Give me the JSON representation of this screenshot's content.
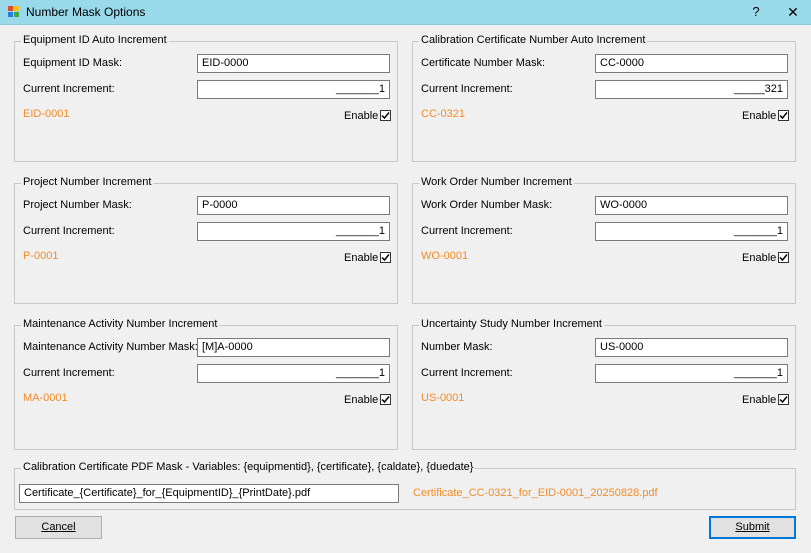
{
  "window": {
    "title": "Number Mask Options",
    "help_glyph": "?",
    "close_glyph": "✕"
  },
  "groups": [
    {
      "legend": "Equipment ID Auto Increment",
      "mask_label": "Equipment ID Mask:",
      "mask_value": "EID-0000",
      "inc_label": "Current Increment:",
      "inc_value": "_______1",
      "preview": "EID-0001",
      "enable_label": "Enable",
      "enabled": true
    },
    {
      "legend": "Calibration Certificate Number Auto Increment",
      "mask_label": "Certificate Number Mask:",
      "mask_value": "CC-0000",
      "inc_label": "Current Increment:",
      "inc_value": "_____321",
      "preview": "CC-0321",
      "enable_label": "Enable",
      "enabled": true
    },
    {
      "legend": "Project Number Increment",
      "mask_label": "Project Number Mask:",
      "mask_value": "P-0000",
      "inc_label": "Current Increment:",
      "inc_value": "_______1",
      "preview": "P-0001",
      "enable_label": "Enable",
      "enabled": true
    },
    {
      "legend": "Work Order Number Increment",
      "mask_label": "Work Order Number Mask:",
      "mask_value": "WO-0000",
      "inc_label": "Current Increment:",
      "inc_value": "_______1",
      "preview": "WO-0001",
      "enable_label": "Enable",
      "enabled": true
    },
    {
      "legend": "Maintenance Activity Number Increment",
      "mask_label": "Maintenance Activity Number Mask:",
      "mask_value": "[M]A-0000",
      "inc_label": "Current Increment:",
      "inc_value": "_______1",
      "preview": "MA-0001",
      "enable_label": "Enable",
      "enabled": true
    },
    {
      "legend": "Uncertainty Study Number Increment",
      "mask_label": "Number Mask:",
      "mask_value": "US-0000",
      "inc_label": "Current Increment:",
      "inc_value": "_______1",
      "preview": "US-0001",
      "enable_label": "Enable",
      "enabled": true
    }
  ],
  "pdf": {
    "legend": "Calibration Certificate PDF Mask - Variables: {equipmentid}, {certificate}, {caldate}, {duedate}",
    "mask_value": "Certificate_{Certificate}_for_{EquipmentID}_{PrintDate}.pdf",
    "preview": "Certificate_CC-0321_for_EID-0001_20250828.pdf"
  },
  "buttons": {
    "cancel_label": "Cancel",
    "submit_label": "Submit"
  },
  "colors": {
    "titlebar": "#99d9ea",
    "preview_text": "#f28c28",
    "default_button_border": "#0078d7"
  },
  "icons": {
    "app": "app-icon",
    "help": "help-icon",
    "close": "close-icon",
    "check": "checkmark-icon"
  }
}
